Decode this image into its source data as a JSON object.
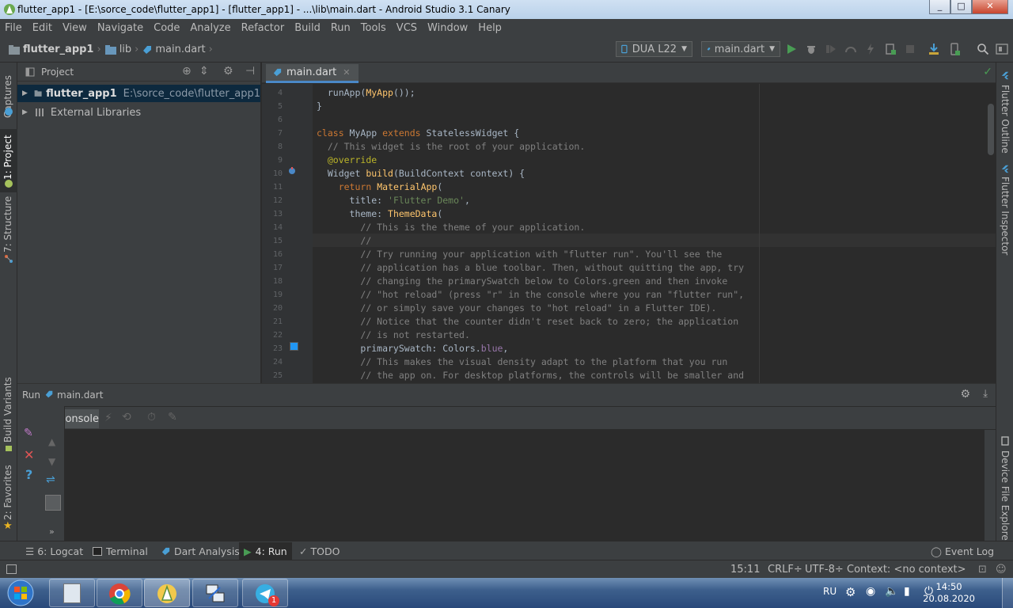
{
  "window": {
    "title": "flutter_app1 - [E:\\sorce_code\\flutter_app1] - [flutter_app1] - ...\\lib\\main.dart - Android Studio 3.1 Canary",
    "minimize": "_",
    "maximize": "□",
    "close": "✕"
  },
  "menu": [
    "File",
    "Edit",
    "View",
    "Navigate",
    "Code",
    "Analyze",
    "Refactor",
    "Build",
    "Run",
    "Tools",
    "VCS",
    "Window",
    "Help"
  ],
  "breadcrumbs": [
    "flutter_app1",
    "lib",
    "main.dart"
  ],
  "toolbar": {
    "device": "DUA L22",
    "run_config": "main.dart"
  },
  "left_stripe": {
    "captures": "Captures",
    "project": "1: Project",
    "structure": "7: Structure",
    "build_variants": "Build Variants",
    "favorites": "2: Favorites"
  },
  "right_stripe": {
    "flutter_outline": "Flutter Outline",
    "flutter_inspector": "Flutter Inspector",
    "device_file_explorer": "Device File Explorer"
  },
  "project_panel": {
    "view": "Project",
    "items": [
      {
        "name": "flutter_app1",
        "path": "E:\\sorce_code\\flutter_app1"
      },
      {
        "name": "External Libraries",
        "path": ""
      }
    ]
  },
  "editor": {
    "tab": "main.dart",
    "lines": [
      {
        "n": "4",
        "html": "  runApp(<span class=\"fn\">MyApp</span>());"
      },
      {
        "n": "5",
        "html": "}"
      },
      {
        "n": "6",
        "html": ""
      },
      {
        "n": "7",
        "html": "<span class=\"kw\">class</span> MyApp <span class=\"kw\">extends</span> StatelessWidget {"
      },
      {
        "n": "8",
        "html": "  <span class=\"cm\">// This widget is the root of your application.</span>"
      },
      {
        "n": "9",
        "html": "  <span class=\"an\">@override</span>"
      },
      {
        "n": "10",
        "html": "  Widget <span class=\"fn\">build</span>(BuildContext context) {"
      },
      {
        "n": "11",
        "html": "    <span class=\"kw\">return</span> <span class=\"fn\">MaterialApp</span>("
      },
      {
        "n": "12",
        "html": "      title: <span class=\"st\">'Flutter Demo'</span>,"
      },
      {
        "n": "13",
        "html": "      theme: <span class=\"fn\">ThemeData</span>("
      },
      {
        "n": "14",
        "html": "        <span class=\"cm\">// This is the theme of your application.</span>"
      },
      {
        "n": "15",
        "html": "        <span class=\"cm\">//</span>"
      },
      {
        "n": "16",
        "html": "        <span class=\"cm\">// Try running your application with \"flutter run\". You'll see the</span>"
      },
      {
        "n": "17",
        "html": "        <span class=\"cm\">// application has a blue toolbar. Then, without quitting the app, try</span>"
      },
      {
        "n": "18",
        "html": "        <span class=\"cm\">// changing the primarySwatch below to Colors.green and then invoke</span>"
      },
      {
        "n": "19",
        "html": "        <span class=\"cm\">// \"hot reload\" (press \"r\" in the console where you ran \"flutter run\",</span>"
      },
      {
        "n": "20",
        "html": "        <span class=\"cm\">// or simply save your changes to \"hot reload\" in a Flutter IDE).</span>"
      },
      {
        "n": "21",
        "html": "        <span class=\"cm\">// Notice that the counter didn't reset back to zero; the application</span>"
      },
      {
        "n": "22",
        "html": "        <span class=\"cm\">// is not restarted.</span>"
      },
      {
        "n": "23",
        "html": "        primarySwatch: Colors.<span class=\"pl\">blue</span>,"
      },
      {
        "n": "24",
        "html": "        <span class=\"cm\">// This makes the visual density adapt to the platform that you run</span>"
      },
      {
        "n": "25",
        "html": "        <span class=\"cm\">// the app on. For desktop platforms, the controls will be smaller and</span>"
      }
    ]
  },
  "run_panel": {
    "label": "Run",
    "config": "main.dart",
    "console_tab": "Console"
  },
  "bottom_tabs": [
    {
      "label": "6: Logcat"
    },
    {
      "label": "Terminal"
    },
    {
      "label": "Dart Analysis"
    },
    {
      "label": "4: Run"
    },
    {
      "label": "TODO"
    }
  ],
  "event_log": "Event Log",
  "status": {
    "position": "15:11",
    "line_sep": "CRLF÷",
    "encoding": "UTF-8÷",
    "context": "Context: <no context>"
  },
  "taskbar": {
    "lang": "RU",
    "time": "14:50",
    "date": "20.08.2020",
    "badge": "1"
  },
  "colors": {
    "selection": "#0d293e",
    "accent_blue": "#4a88c7",
    "run_green": "#499c54"
  }
}
